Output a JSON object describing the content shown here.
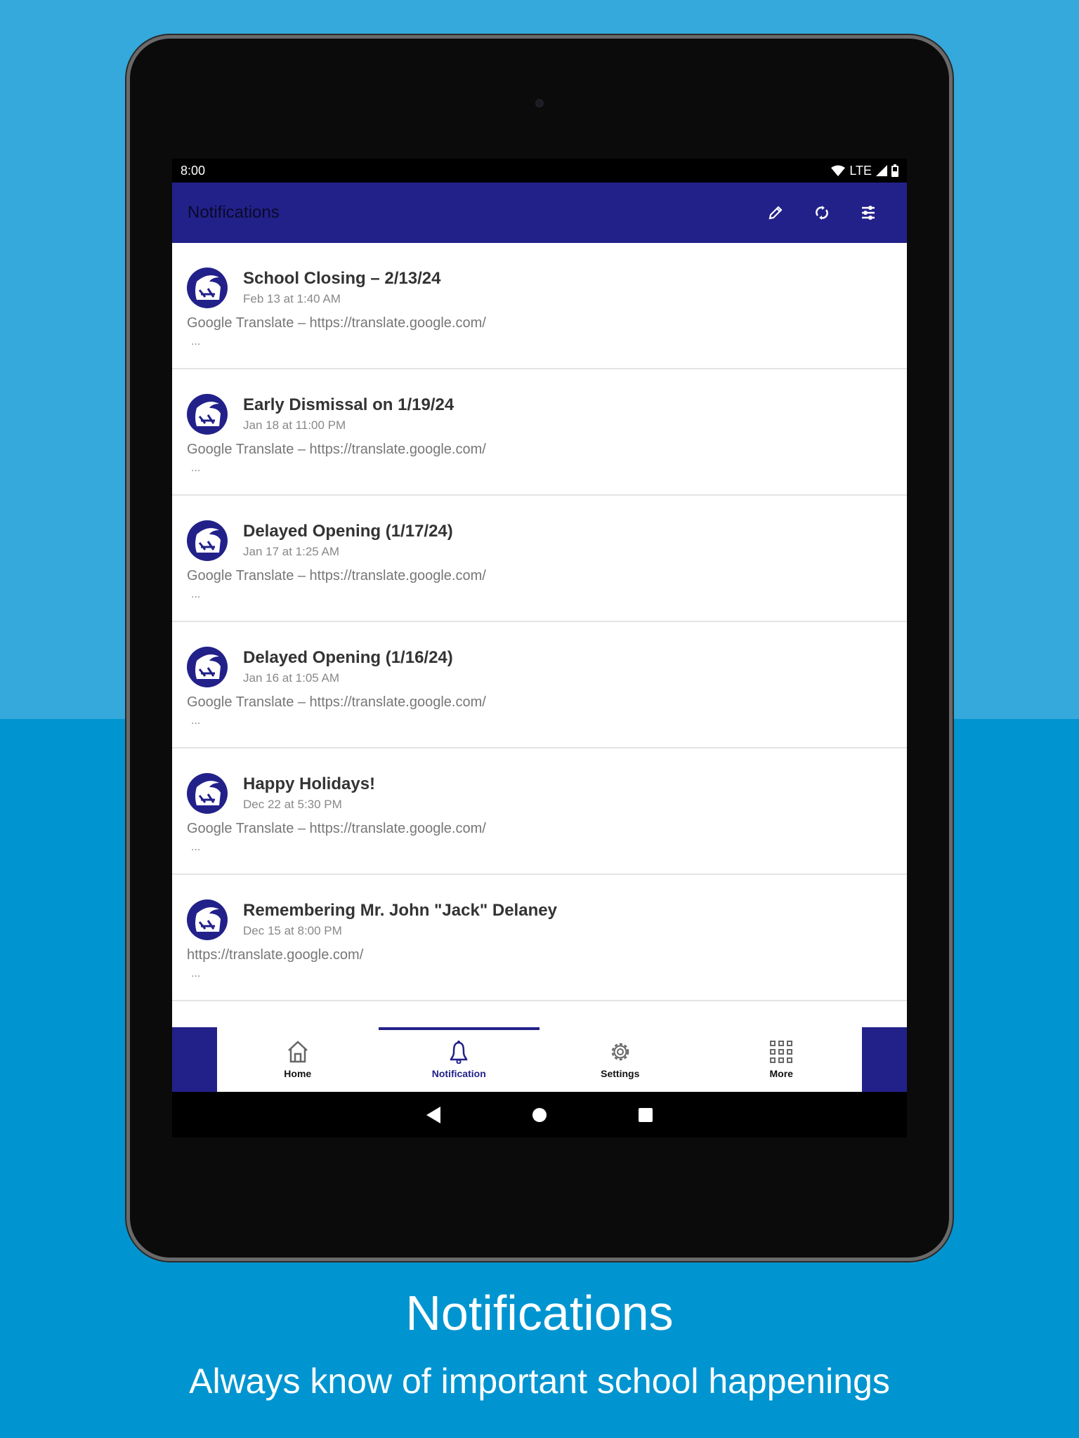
{
  "status_bar": {
    "time": "8:00",
    "network": "LTE"
  },
  "app_bar": {
    "title": "Notifications",
    "actions": [
      "pencil-icon",
      "refresh-icon",
      "filter-sliders-icon"
    ]
  },
  "notifications": [
    {
      "title": "School Closing – 2/13/24",
      "date": "Feb 13 at 1:40 AM",
      "body": "Google Translate – https://translate.google.com/",
      "more": "..."
    },
    {
      "title": "Early Dismissal on 1/19/24",
      "date": "Jan 18 at 11:00 PM",
      "body": "Google Translate – https://translate.google.com/",
      "more": "..."
    },
    {
      "title": "Delayed Opening (1/17/24)",
      "date": "Jan 17 at 1:25 AM",
      "body": "Google Translate – https://translate.google.com/",
      "more": "..."
    },
    {
      "title": "Delayed Opening (1/16/24)",
      "date": "Jan 16 at 1:05 AM",
      "body": "Google Translate – https://translate.google.com/",
      "more": "..."
    },
    {
      "title": "Happy Holidays!",
      "date": "Dec 22 at 5:30 PM",
      "body": "Google Translate – https://translate.google.com/",
      "more": "..."
    },
    {
      "title": "Remembering Mr. John \"Jack\" Delaney",
      "date": "Dec 15 at 8:00 PM",
      "body": "https://translate.google.com/",
      "more": "..."
    }
  ],
  "bottom_nav": {
    "items": [
      {
        "label": "Home"
      },
      {
        "label": "Notification"
      },
      {
        "label": "Settings"
      },
      {
        "label": "More"
      }
    ],
    "active": "Notification"
  },
  "caption": {
    "title": "Notifications",
    "subtitle": "Always know of important school happenings"
  },
  "colors": {
    "brand": "#22218A",
    "bg_top": "#35A8DC",
    "bg_bottom": "#0095D0"
  }
}
